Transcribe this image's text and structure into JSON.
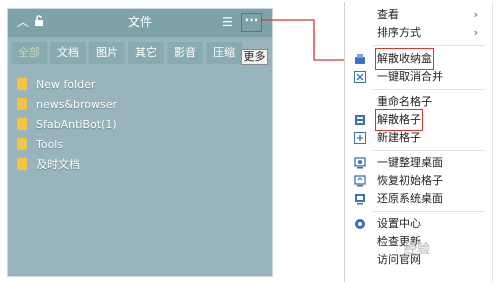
{
  "fence": {
    "title": "文件",
    "tabs": [
      "全部",
      "文档",
      "图片",
      "其它",
      "影音",
      "压缩"
    ],
    "more_glyph": "···",
    "tooltip": "更多",
    "items": [
      {
        "label": "New folder"
      },
      {
        "label": "news&browser"
      },
      {
        "label": "SfabAntiBot(1)"
      },
      {
        "label": "Tools"
      },
      {
        "label": "及时文档"
      }
    ]
  },
  "menu": {
    "view": "查看",
    "sort": "排序方式",
    "dissolve_box": "解散收纳盒",
    "cancel_merge": "一键取消合并",
    "rename_fence": "重命名格子",
    "dissolve_fence": "解散格子",
    "new_fence": "新建格子",
    "organize_desktop": "一键整理桌面",
    "restore_fences": "恢复初始格子",
    "restore_desktop": "还原系统桌面",
    "settings": "设置中心",
    "check_update": "检查更新",
    "visit_site": "访问官网"
  },
  "watermark": "经验",
  "colors": {
    "highlight": "#e0342f",
    "folder": "#f5c542",
    "fence_bg": "#98b5bd"
  }
}
